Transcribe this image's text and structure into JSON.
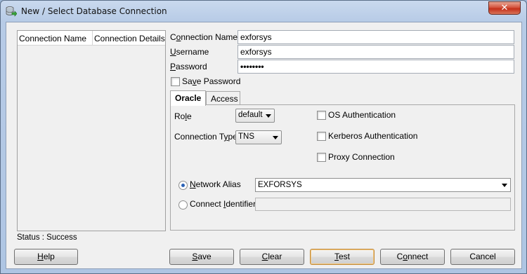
{
  "window": {
    "title": "New / Select Database Connection",
    "close_glyph": "✕"
  },
  "conn_list": {
    "columns": [
      "Connection Name",
      "Connection Details"
    ]
  },
  "status": "Status : Success",
  "form": {
    "connection_name": {
      "label_pre": "C",
      "label_u": "o",
      "label_post": "nnection Name",
      "value": "exforsys"
    },
    "username": {
      "label_u": "U",
      "label_post": "sername",
      "value": "exforsys"
    },
    "password": {
      "label_u": "P",
      "label_post": "assword",
      "value": "••••••••"
    },
    "save_password": {
      "label_pre": "Sa",
      "label_u": "v",
      "label_post": "e Password",
      "checked": false
    }
  },
  "tabs": [
    {
      "label": "Oracle",
      "active": true
    },
    {
      "label": "Access",
      "active": false
    }
  ],
  "oracle": {
    "role": {
      "label_pre": "Ro",
      "label_u": "l",
      "label_post": "e",
      "value": "default"
    },
    "connection_type": {
      "label_pre": "Connection T",
      "label_u": "y",
      "label_post": "pe",
      "value": "TNS"
    },
    "os_auth": {
      "label": "OS Authentication",
      "checked": false
    },
    "kerberos_auth": {
      "label": "Kerberos Authentication",
      "checked": false
    },
    "proxy_conn": {
      "label": "Proxy Connection",
      "checked": false
    },
    "network_alias": {
      "label_pre": "",
      "label_u": "N",
      "label_post": "etwork Alias",
      "value": "EXFORSYS",
      "selected": true
    },
    "connect_identifier": {
      "label_pre": "Connect ",
      "label_u": "I",
      "label_post": "dentifier",
      "value": "",
      "selected": false
    }
  },
  "buttons": {
    "help": {
      "u": "H",
      "post": "elp"
    },
    "save": {
      "u": "S",
      "post": "ave"
    },
    "clear": {
      "u": "C",
      "post": "lear"
    },
    "test": {
      "u": "T",
      "post": "est"
    },
    "connect": {
      "pre": "C",
      "u": "o",
      "post": "nnect"
    },
    "cancel": {
      "label": "Cancel"
    }
  },
  "icons": {
    "app": "database-connection-icon",
    "close": "close-icon",
    "dropdown": "chevron-down-icon"
  }
}
